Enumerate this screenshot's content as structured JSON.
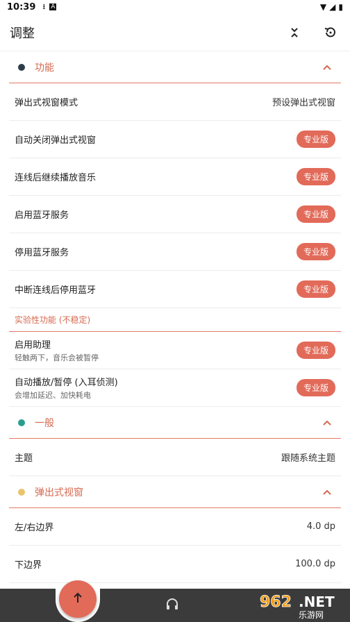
{
  "status": {
    "time": "10:39"
  },
  "toolbar": {
    "title": "调整"
  },
  "sections": {
    "function": {
      "title": "功能",
      "dot_color": "#2f3d48",
      "rows": [
        {
          "label": "弹出式视窗模式",
          "value": "预设弹出式视窗"
        },
        {
          "label": "自动关闭弹出式视窗",
          "badge": "专业版"
        },
        {
          "label": "连线后继续播放音乐",
          "badge": "专业版"
        },
        {
          "label": "启用蓝牙服务",
          "badge": "专业版"
        },
        {
          "label": "停用蓝牙服务",
          "badge": "专业版"
        },
        {
          "label": "中断连线后停用蓝牙",
          "badge": "专业版"
        }
      ],
      "experimental": {
        "title": "实验性功能 (不稳定)",
        "rows": [
          {
            "label": "启用助理",
            "sub": "轻触两下，音乐会被暂停",
            "badge": "专业版"
          },
          {
            "label": "自动播放/暂停 (入耳侦测)",
            "sub": "会增加延迟、加快耗电",
            "badge": "专业版"
          }
        ]
      }
    },
    "general": {
      "title": "一般",
      "dot_color": "#2a9d8f",
      "rows": [
        {
          "label": "主题",
          "value": "跟随系统主题"
        }
      ]
    },
    "popup": {
      "title": "弹出式视窗",
      "dot_color": "#e9c46a",
      "rows": [
        {
          "label": "左/右边界",
          "value": "4.0 dp"
        },
        {
          "label": "下边界",
          "value": "100.0 dp"
        }
      ]
    }
  },
  "watermark": {
    "text": "962.NET",
    "sub": "乐游网"
  },
  "icons": [
    "download-icon",
    "a-icon",
    "wifi-icon",
    "signal-icon",
    "battery-icon",
    "collapse-icon",
    "restore-icon",
    "chevron-up-icon",
    "arrow-up-icon",
    "headphones-icon"
  ]
}
